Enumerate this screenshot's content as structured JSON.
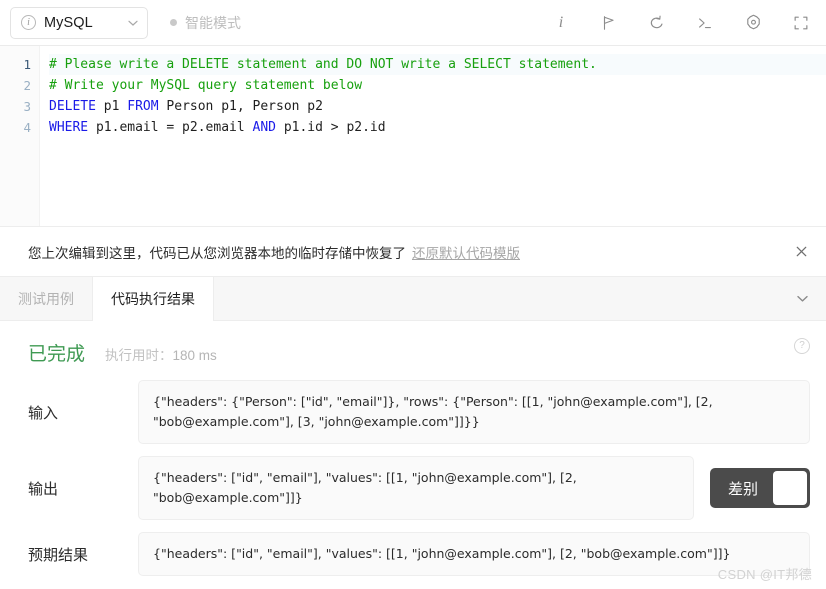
{
  "toolbar": {
    "language": "MySQL",
    "info_icon": "info-circle-icon",
    "dropdown_icon": "chevron-down-icon",
    "smart_mode_label": "智能模式",
    "icons": [
      {
        "name": "info-icon",
        "glyph": "i"
      },
      {
        "name": "flag-icon",
        "glyph": "flag"
      },
      {
        "name": "reset-icon",
        "glyph": "undo"
      },
      {
        "name": "console-icon",
        "glyph": ">_"
      },
      {
        "name": "settings-icon",
        "glyph": "gear"
      },
      {
        "name": "fullscreen-icon",
        "glyph": "expand"
      }
    ]
  },
  "editor": {
    "line_numbers": [
      "1",
      "2",
      "3",
      "4"
    ],
    "lines": [
      {
        "n": "1",
        "tokens": [
          {
            "t": "c",
            "s": "# Please write a DELETE statement and DO NOT write a SELECT statement."
          }
        ]
      },
      {
        "n": "2",
        "tokens": [
          {
            "t": "c",
            "s": "# Write your MySQL query statement below"
          }
        ]
      },
      {
        "n": "3",
        "tokens": [
          {
            "t": "k",
            "s": "DELETE"
          },
          {
            "t": "p",
            "s": " p1 "
          },
          {
            "t": "k",
            "s": "FROM"
          },
          {
            "t": "p",
            "s": " Person p1, Person p2"
          }
        ]
      },
      {
        "n": "4",
        "tokens": [
          {
            "t": "k",
            "s": "WHERE"
          },
          {
            "t": "p",
            "s": " p1.email = p2.email "
          },
          {
            "t": "k",
            "s": "AND"
          },
          {
            "t": "p",
            "s": " p1.id > p2.id"
          }
        ]
      }
    ]
  },
  "notice": {
    "message": "您上次编辑到这里，代码已从您浏览器本地的临时存储中恢复了",
    "link_label": "还原默认代码模版",
    "close_icon": "close-icon"
  },
  "tabs": [
    {
      "label": "测试用例",
      "active": false
    },
    {
      "label": "代码执行结果",
      "active": true
    }
  ],
  "tabbar": {
    "collapse_icon": "chevron-down-icon"
  },
  "result": {
    "status": "已完成",
    "runtime_label": "执行用时：",
    "runtime_value": "180 ms",
    "help_icon": "question-mark-icon",
    "input_label": "输入",
    "input_value": "{\"headers\": {\"Person\": [\"id\", \"email\"]}, \"rows\": {\"Person\": [[1, \"john@example.com\"], [2, \"bob@example.com\"], [3, \"john@example.com\"]]}}",
    "output_label": "输出",
    "output_value": "{\"headers\": [\"id\", \"email\"], \"values\": [[1, \"john@example.com\"], [2, \"bob@example.com\"]]}",
    "expected_label": "预期结果",
    "expected_value": "{\"headers\": [\"id\", \"email\"], \"values\": [[1, \"john@example.com\"], [2, \"bob@example.com\"]]}",
    "diff_toggle_label": "差别"
  },
  "watermark": "CSDN @IT邦德",
  "colors": {
    "comment": "#17a00e",
    "keyword": "#1a1ae8",
    "success": "#3f9a53",
    "toggle": "#4b4b4b"
  }
}
